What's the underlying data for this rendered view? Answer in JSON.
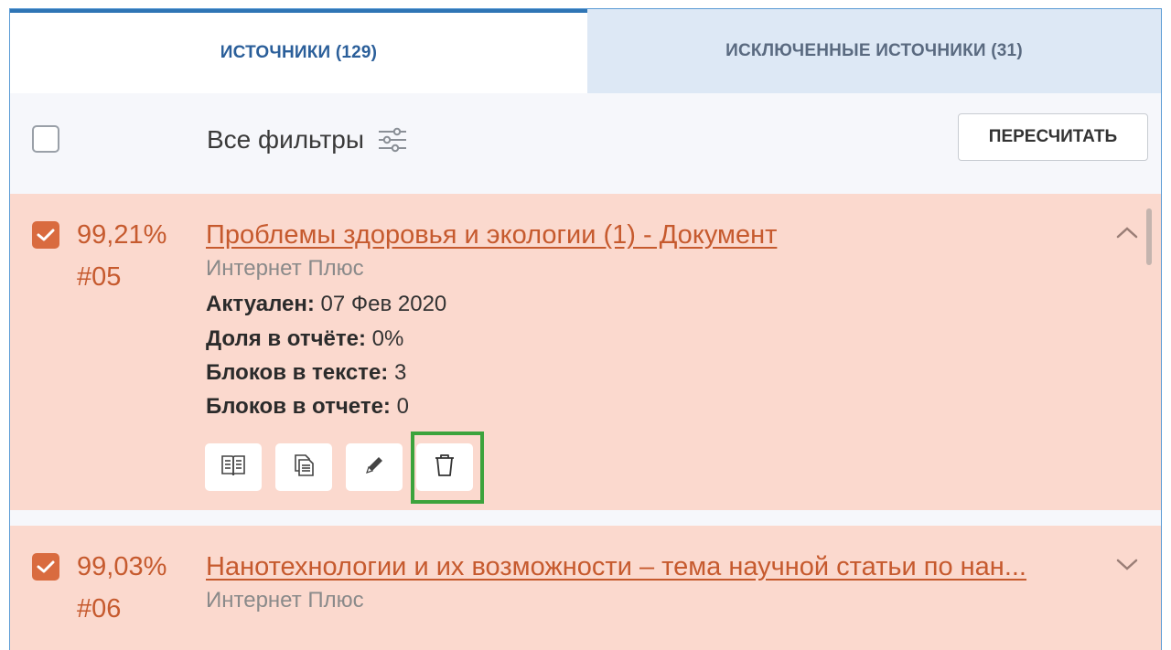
{
  "tabs": [
    {
      "label": "ИСТОЧНИКИ (129)",
      "active": true
    },
    {
      "label": "ИСКЛЮЧЕННЫЕ ИСТОЧНИКИ (31)",
      "active": false
    }
  ],
  "toolbar": {
    "filters_label": "Все фильтры",
    "filters_icon": "sliders-icon",
    "recalc_label": "ПЕРЕСЧИТАТЬ",
    "select_all_checked": false
  },
  "sources": [
    {
      "checked": true,
      "percent": "99,21%",
      "number": "#05",
      "title": "Проблемы здоровья и экологии (1) - Документ",
      "source": "Интернет Плюс",
      "expanded": true,
      "meta": [
        {
          "label": "Актуален:",
          "value": " 07 Фев 2020"
        },
        {
          "label": "Доля в отчёте:",
          "value": " 0%"
        },
        {
          "label": "Блоков в тексте:",
          "value": " 3"
        },
        {
          "label": "Блоков в отчете:",
          "value": " 0"
        }
      ],
      "actions": [
        "book-icon",
        "copy-icon",
        "pencil-icon",
        "trash-icon"
      ],
      "highlighted_action": "trash-icon"
    },
    {
      "checked": true,
      "percent": "99,03%",
      "number": "#06",
      "title": "Нанотехнологии и их возможности – тема научной статьи по нан...",
      "source": "Интернет Плюс",
      "expanded": false
    }
  ],
  "colors": {
    "accent": "#c65a2e",
    "card_bg": "#fbd9ce",
    "tab_active_text": "#2b5f9a",
    "highlight": "#3ca33c"
  }
}
